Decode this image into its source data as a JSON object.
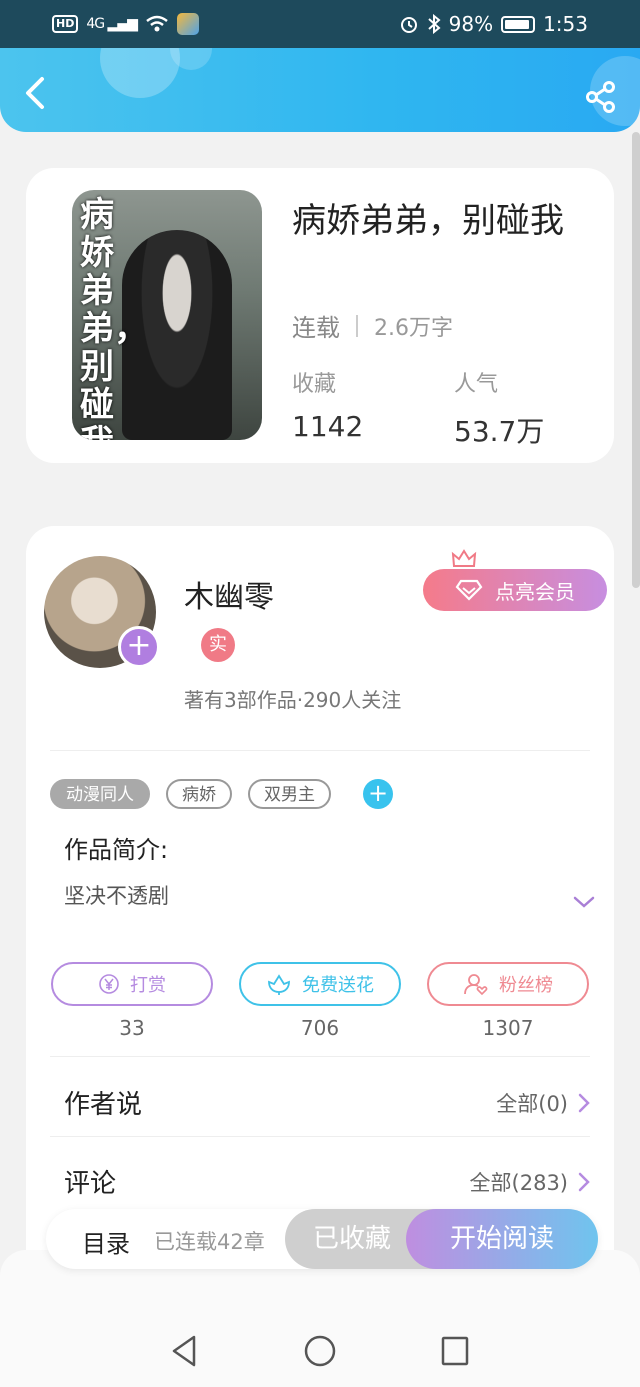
{
  "status_bar": {
    "hd": "HD",
    "signal": "4G",
    "battery": "98%",
    "time": "1:53"
  },
  "book": {
    "cover_title": "病娇弟弟，别碰我",
    "title": "病娇弟弟，别碰我",
    "status": "连载",
    "word_count": "2.6万字",
    "favorites_label": "收藏",
    "favorites_value": "1142",
    "popularity_label": "人气",
    "popularity_value": "53.7万"
  },
  "author": {
    "name": "木幽零",
    "verified_badge": "实",
    "plus": "+",
    "summary": "著有3部作品·290人关注",
    "vip_button": "点亮会员"
  },
  "tags": [
    "动漫同人",
    "病娇",
    "双男主"
  ],
  "tag_add": "+",
  "intro": {
    "label": "作品简介:",
    "text": "坚决不透剧"
  },
  "actions": [
    {
      "label": "打赏",
      "count": "33",
      "color": "#b58be0",
      "icon": "yen-icon"
    },
    {
      "label": "免费送花",
      "count": "706",
      "color": "#3fc2e8",
      "icon": "flower-icon"
    },
    {
      "label": "粉丝榜",
      "count": "1307",
      "color": "#ef8a92",
      "icon": "fan-rank-icon"
    }
  ],
  "author_says": {
    "title": "作者说",
    "more": "全部(0)"
  },
  "comments": {
    "title": "评论",
    "more": "全部(283)"
  },
  "bottom_bar": {
    "catalog": "目录",
    "chapters": "已连载42章",
    "collected": "已收藏",
    "start_reading": "开始阅读"
  },
  "colors": {
    "header_start": "#4cc4ee",
    "header_end": "#29a9f2",
    "accent_purple": "#b07ee0",
    "vip_gradient_start": "#f57b8a",
    "vip_gradient_end": "#c78ee0"
  }
}
